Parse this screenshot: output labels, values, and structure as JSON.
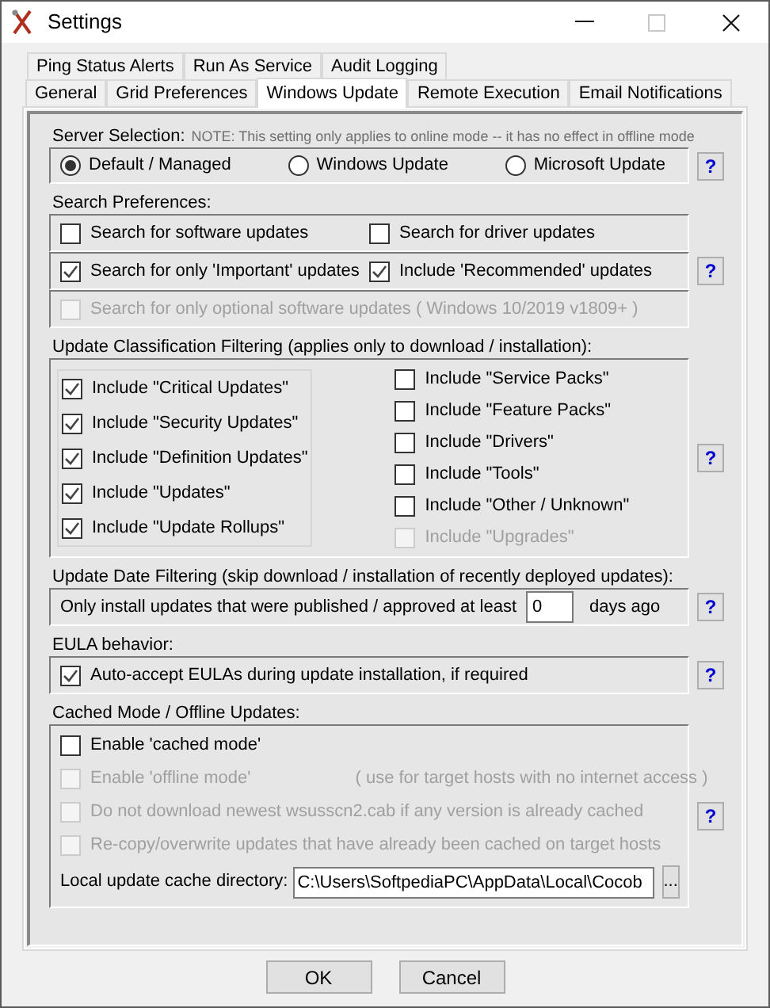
{
  "window": {
    "title": "Settings"
  },
  "tabs": [
    [
      {
        "label": "Ping Status Alerts",
        "selected": false
      },
      {
        "label": "Run As Service",
        "selected": false
      },
      {
        "label": "Audit Logging",
        "selected": false
      }
    ],
    [
      {
        "label": "General",
        "selected": false
      },
      {
        "label": "Grid Preferences",
        "selected": false
      },
      {
        "label": "Windows Update",
        "selected": true
      },
      {
        "label": "Remote Execution",
        "selected": false
      },
      {
        "label": "Email Notifications",
        "selected": false
      }
    ]
  ],
  "sections": [
    {
      "kind": "radio",
      "heading": "Server Selection:",
      "note": "NOTE: This setting only applies to online mode -- it has no effect in offline mode",
      "help": "?",
      "options": [
        {
          "label": "Default / Managed",
          "selected": true
        },
        {
          "label": "Windows Update",
          "selected": false
        },
        {
          "label": "Microsoft Update",
          "selected": false
        }
      ]
    },
    {
      "kind": "grid",
      "heading": "Search Preferences:",
      "help": "?",
      "rows": [
        [
          {
            "label": "Search for software updates",
            "checked": false,
            "disabled": false
          },
          {
            "label": "Search for driver updates",
            "checked": false,
            "disabled": false
          }
        ],
        [
          {
            "label": "Search for only 'Important' updates",
            "checked": true,
            "disabled": false
          },
          {
            "label": "Include 'Recommended' updates",
            "checked": true,
            "disabled": false
          }
        ],
        [
          {
            "label": "Search for only optional software updates  ( Windows 10/2019 v1809+ )",
            "checked": false,
            "disabled": true
          }
        ]
      ]
    },
    {
      "kind": "columns",
      "heading": "Update Classification Filtering (applies only to download / installation):",
      "help": "?",
      "columns": [
        [
          {
            "label": "Include \"Critical Updates\"",
            "checked": true,
            "disabled": false
          },
          {
            "label": "Include \"Security Updates\"",
            "checked": true,
            "disabled": false
          },
          {
            "label": "Include \"Definition Updates\"",
            "checked": true,
            "disabled": false
          },
          {
            "label": "Include \"Updates\"",
            "checked": true,
            "disabled": false
          },
          {
            "label": "Include \"Update Rollups\"",
            "checked": true,
            "disabled": false
          }
        ],
        [
          {
            "label": "Include \"Service Packs\"",
            "checked": false,
            "disabled": false
          },
          {
            "label": "Include \"Feature Packs\"",
            "checked": false,
            "disabled": false
          },
          {
            "label": "Include \"Drivers\"",
            "checked": false,
            "disabled": false
          },
          {
            "label": "Include \"Tools\"",
            "checked": false,
            "disabled": false
          },
          {
            "label": "Include \"Other / Unknown\"",
            "checked": false,
            "disabled": false
          },
          {
            "label": "Include \"Upgrades\"",
            "checked": false,
            "disabled": true
          }
        ]
      ]
    },
    {
      "kind": "days",
      "heading": "Update Date Filtering (skip download / installation of recently deployed updates):",
      "help": "?",
      "prefix": "Only install updates that were published / approved at least",
      "value": "0",
      "suffix": "days ago"
    },
    {
      "kind": "list",
      "heading": "EULA behavior:",
      "help": "?",
      "items": [
        {
          "label": "Auto-accept EULAs during update installation, if required",
          "checked": true,
          "disabled": false
        }
      ]
    },
    {
      "kind": "cached",
      "heading": "Cached Mode / Offline Updates:",
      "help": "?",
      "items": [
        {
          "label": "Enable 'cached mode'",
          "checked": false,
          "disabled": false
        },
        {
          "label": "Enable 'offline mode'",
          "note": "( use for target hosts with no internet access )",
          "checked": false,
          "disabled": true
        },
        {
          "label": "Do not download newest wsusscn2.cab if any version is already cached",
          "checked": false,
          "disabled": true
        },
        {
          "label": "Re-copy/overwrite updates that have already been cached on target hosts",
          "checked": false,
          "disabled": true
        }
      ],
      "directory": {
        "label": "Local update cache directory:",
        "value": "C:\\Users\\SoftpediaPC\\AppData\\Local\\Cocob",
        "browse": "..."
      }
    }
  ],
  "buttons": [
    {
      "label": "OK"
    },
    {
      "label": "Cancel"
    }
  ]
}
